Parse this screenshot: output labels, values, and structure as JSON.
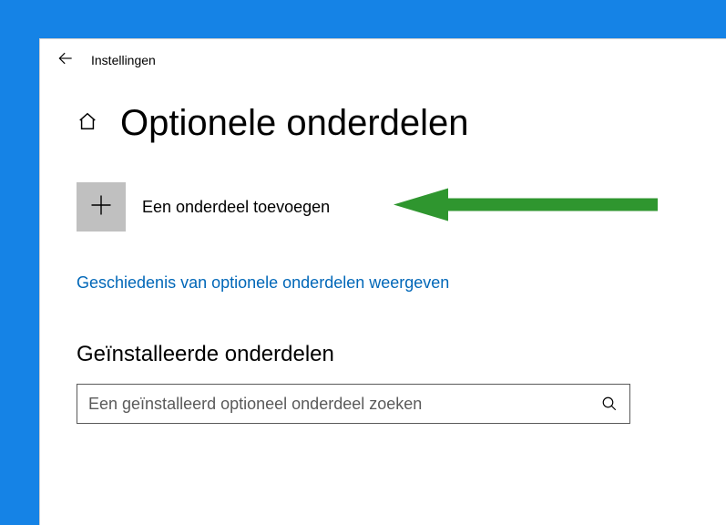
{
  "app": {
    "title": "Instellingen"
  },
  "page": {
    "title": "Optionele onderdelen"
  },
  "add": {
    "label": "Een onderdeel toevoegen"
  },
  "history": {
    "link": "Geschiedenis van optionele onderdelen weergeven"
  },
  "installed": {
    "heading": "Geïnstalleerde onderdelen",
    "search_placeholder": "Een geïnstalleerd optioneel onderdeel zoeken"
  },
  "colors": {
    "desktop": "#1583e6",
    "link": "#0067b8",
    "arrow": "#2f962f"
  }
}
